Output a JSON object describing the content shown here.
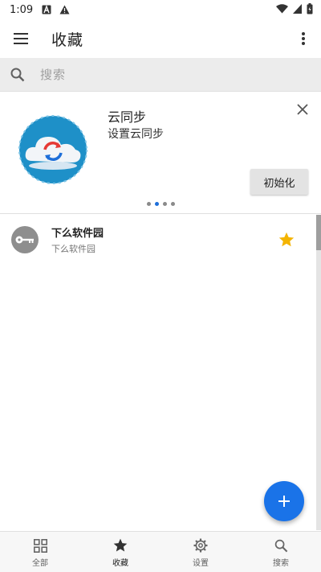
{
  "status_bar": {
    "time": "1:09",
    "icons": [
      "a-notification-icon",
      "warning-icon",
      "wifi-icon",
      "signal-icon",
      "battery-icon"
    ]
  },
  "app_bar": {
    "title": "收藏",
    "menu_icon": "menu-icon",
    "more_icon": "more-vert-icon"
  },
  "search": {
    "placeholder": "搜索",
    "icon": "search-icon"
  },
  "banner": {
    "title": "云同步",
    "subtitle": "设置云同步",
    "button_label": "初始化",
    "page_count": 4,
    "active_page": 1,
    "colors": {
      "accent": "#1e6fd9",
      "button_bg": "#e3e3e3"
    }
  },
  "list": {
    "items": [
      {
        "title": "下么软件园",
        "subtitle": "下么软件园",
        "icon": "key-icon",
        "starred": true
      }
    ]
  },
  "fab": {
    "icon": "plus-icon",
    "color": "#1a73e8"
  },
  "bottom_nav": {
    "items": [
      {
        "label": "全部",
        "icon": "grid-icon"
      },
      {
        "label": "收藏",
        "icon": "star-icon"
      },
      {
        "label": "设置",
        "icon": "gear-icon"
      },
      {
        "label": "搜索",
        "icon": "search-icon"
      }
    ],
    "active_index": 1
  },
  "colors": {
    "star": "#f4b400",
    "avatar": "#8e8e8e"
  }
}
